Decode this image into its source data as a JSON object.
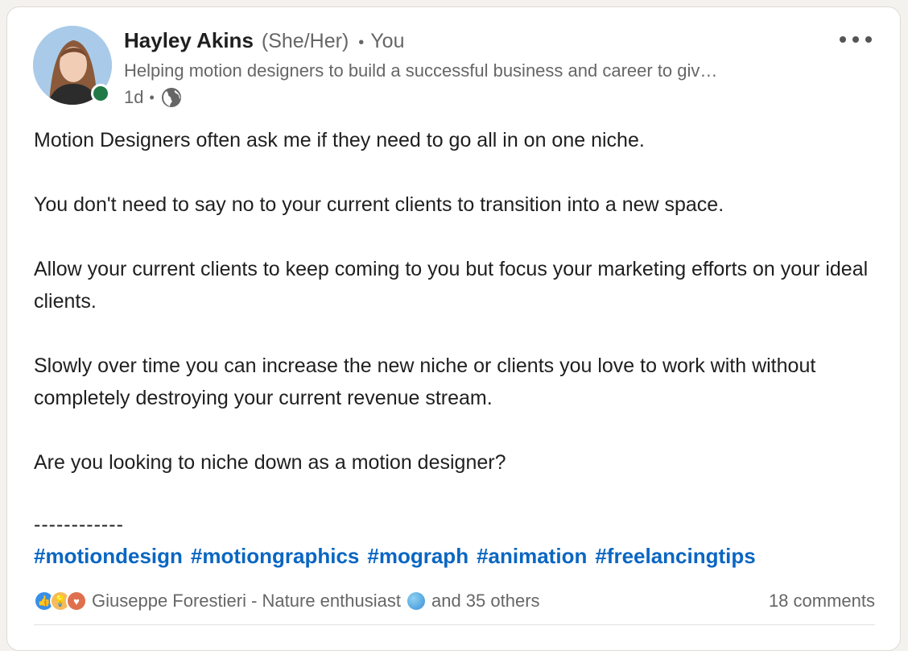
{
  "post": {
    "author": {
      "name": "Hayley Akins",
      "pronouns": "(She/Her)",
      "relation": "You",
      "headline": "Helping motion designers to build a successful business and career to giv…",
      "time": "1d",
      "visibility_icon": "globe-icon",
      "presence_color": "#1f7a48"
    },
    "more_icon": "more-horizontal-icon",
    "paragraphs": [
      "Motion Designers often ask me if they need to go all in on one niche.",
      "You don't need to say no to your current clients to transition into a new space.",
      "Allow your current clients to keep coming to you but focus your marketing efforts on your ideal clients.",
      "Slowly over time you can increase the new niche or clients you love to work with without completely destroying your current revenue stream.",
      "Are you looking to niche down as a motion designer?"
    ],
    "divider": "------------",
    "hashtags": [
      "#motiondesign",
      "#motiongraphics",
      "#mograph",
      "#animation",
      "#freelancingtips"
    ],
    "hashtag_color": "#0a66c2",
    "social": {
      "reaction_icons": [
        "like-icon",
        "insightful-icon",
        "love-icon"
      ],
      "reactor_name": "Giuseppe Forestieri - Nature enthusiast",
      "reactor_emoji": "earth-globe-icon",
      "others": "and 35 others",
      "comments": "18 comments"
    }
  }
}
